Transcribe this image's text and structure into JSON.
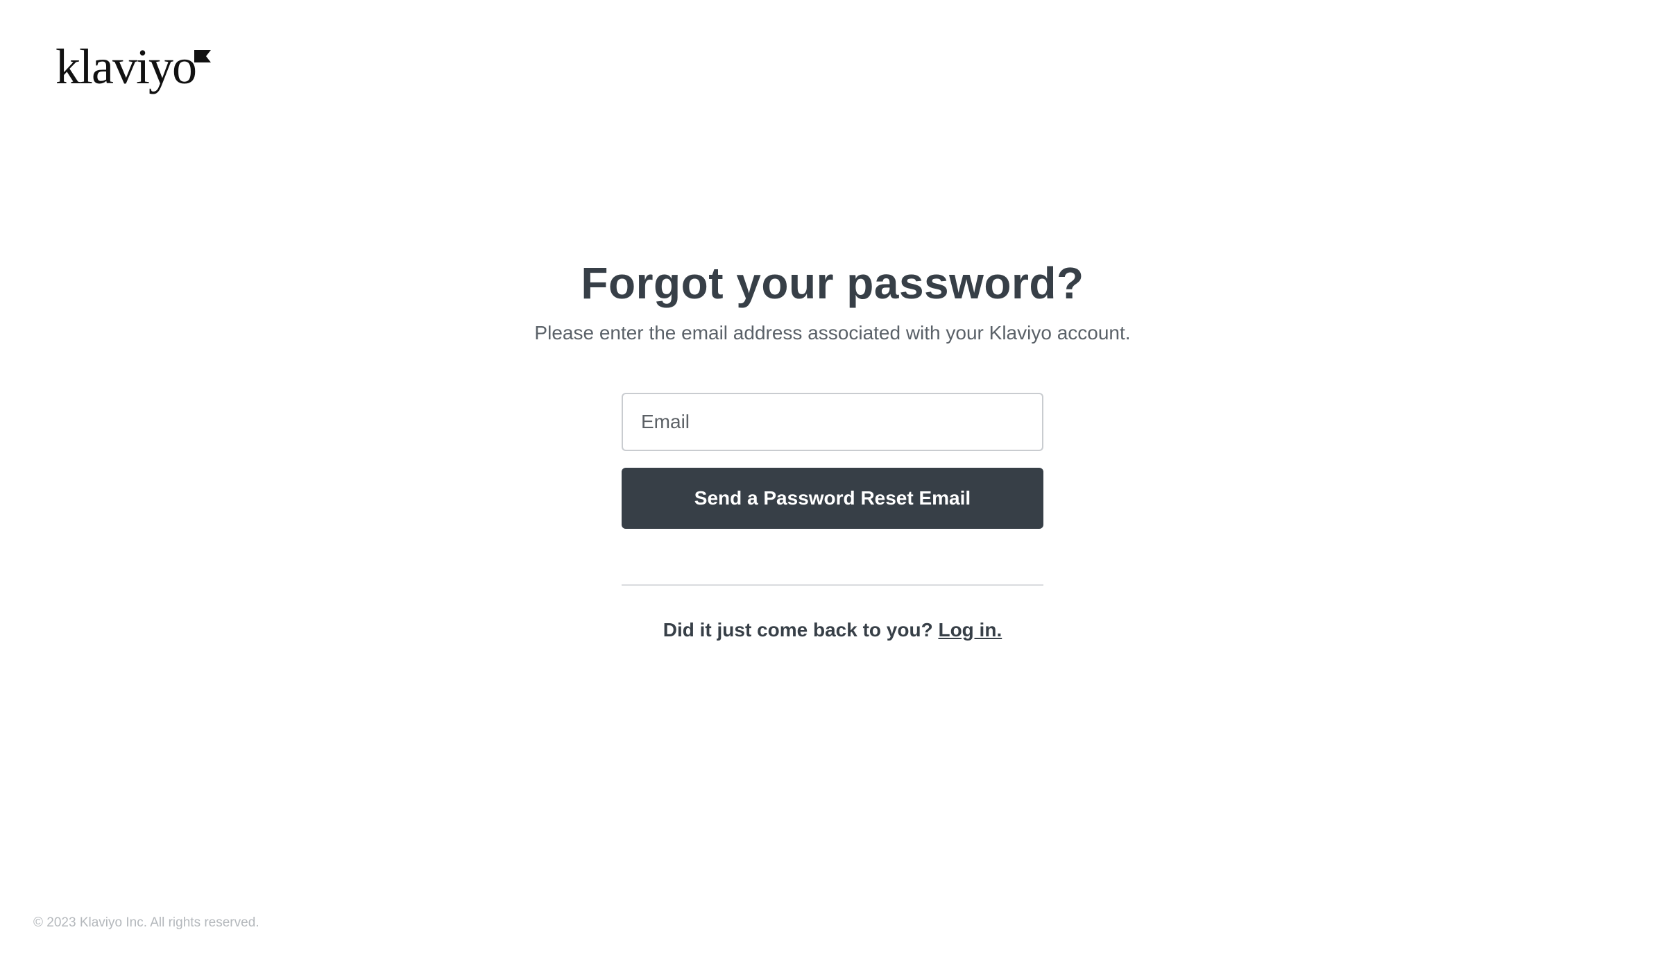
{
  "logo": {
    "text": "klaviyo",
    "icon": "klaviyo-flag-icon"
  },
  "main": {
    "title": "Forgot your password?",
    "subtitle": "Please enter the email address associated with your Klaviyo account."
  },
  "form": {
    "email_placeholder": "Email",
    "email_value": "",
    "submit_label": "Send a Password Reset Email"
  },
  "login_prompt": {
    "text": "Did it just come back to you?",
    "link_label": "Log in."
  },
  "footer": {
    "copyright": "© 2023 Klaviyo Inc. All rights reserved."
  },
  "colors": {
    "primary": "#373f47",
    "subtitle": "#5a6168",
    "input_border": "#c9ccd0",
    "divider": "#d9dbde",
    "footer_text": "#b4b8bc",
    "background": "#ffffff"
  }
}
